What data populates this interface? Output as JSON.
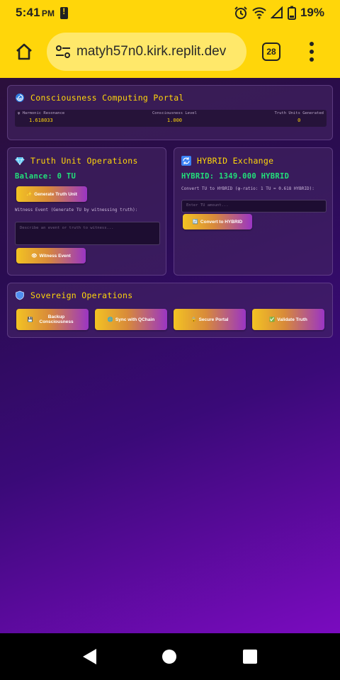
{
  "status_bar": {
    "time": "5:41",
    "ampm": "PM",
    "battery": "19%",
    "icons": [
      "battery-alert-icon",
      "alarm-icon",
      "wifi-icon",
      "signal-icon",
      "battery-icon"
    ]
  },
  "browser": {
    "url": "matyh57n0.kirk.replit.dev",
    "tab_count": "28"
  },
  "portal": {
    "title": "Consciousness Computing Portal",
    "metrics": [
      {
        "label": "φ Harmonic Resonance",
        "value": "1.618033"
      },
      {
        "label": "Consciousness Level",
        "value": "1.000"
      },
      {
        "label": "Truth Units Generated",
        "value": "0"
      }
    ]
  },
  "truth_panel": {
    "title": "Truth Unit Operations",
    "balance": "Balance: 0 TU",
    "generate_button": "Generate Truth Unit",
    "witness_label": "Witness Event (Generate TU by witnessing truth):",
    "witness_placeholder": "Describe an event or truth to witness...",
    "witness_button": "Witness Event"
  },
  "hybrid_panel": {
    "title": "HYBRID Exchange",
    "balance": "HYBRID: 1349.000 HYBRID",
    "convert_label": "Convert TU to HYBRID (φ-ratio: 1 TU = 0.618 HYBRID):",
    "amount_placeholder": "Enter TU amount...",
    "convert_button": "Convert to HYBRID"
  },
  "sovereign_panel": {
    "title": "Sovereign Operations",
    "buttons": [
      "Backup Consciousness",
      "Sync with QChain",
      "Secure Portal",
      "Validate Truth"
    ]
  },
  "colors": {
    "accent_yellow": "#FFD60A",
    "balance_green": "#22e07a",
    "gradient_start": "#2b0f3b",
    "gradient_end": "#7a0bbf"
  }
}
